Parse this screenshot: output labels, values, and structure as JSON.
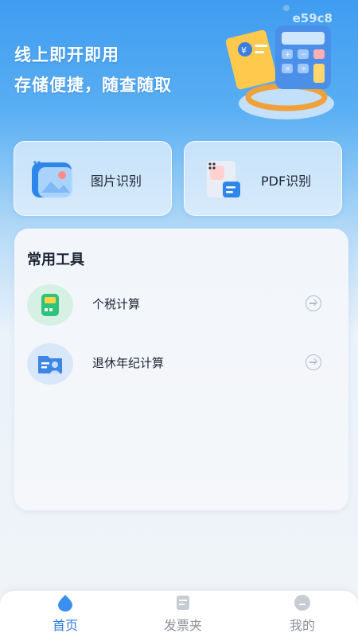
{
  "watermark": "e59c8",
  "hero": {
    "line1": "线上即开即用",
    "line2": "存储便捷，随查随取"
  },
  "cards": [
    {
      "label": "图片识别",
      "icon": "image-recognition-icon"
    },
    {
      "label": "PDF识别",
      "icon": "pdf-recognition-icon"
    }
  ],
  "tools": {
    "title": "常用工具",
    "items": [
      {
        "label": "个税计算",
        "icon": "calculator-icon"
      },
      {
        "label": "退休年纪计算",
        "icon": "retirement-folder-icon"
      }
    ]
  },
  "tabbar": {
    "items": [
      {
        "label": "首页",
        "icon": "home-icon",
        "active": true
      },
      {
        "label": "发票夹",
        "icon": "invoice-folder-icon",
        "active": false
      },
      {
        "label": "我的",
        "icon": "profile-icon",
        "active": false
      }
    ]
  },
  "colors": {
    "accent": "#2f7be0",
    "inactive": "#8b8f97"
  }
}
